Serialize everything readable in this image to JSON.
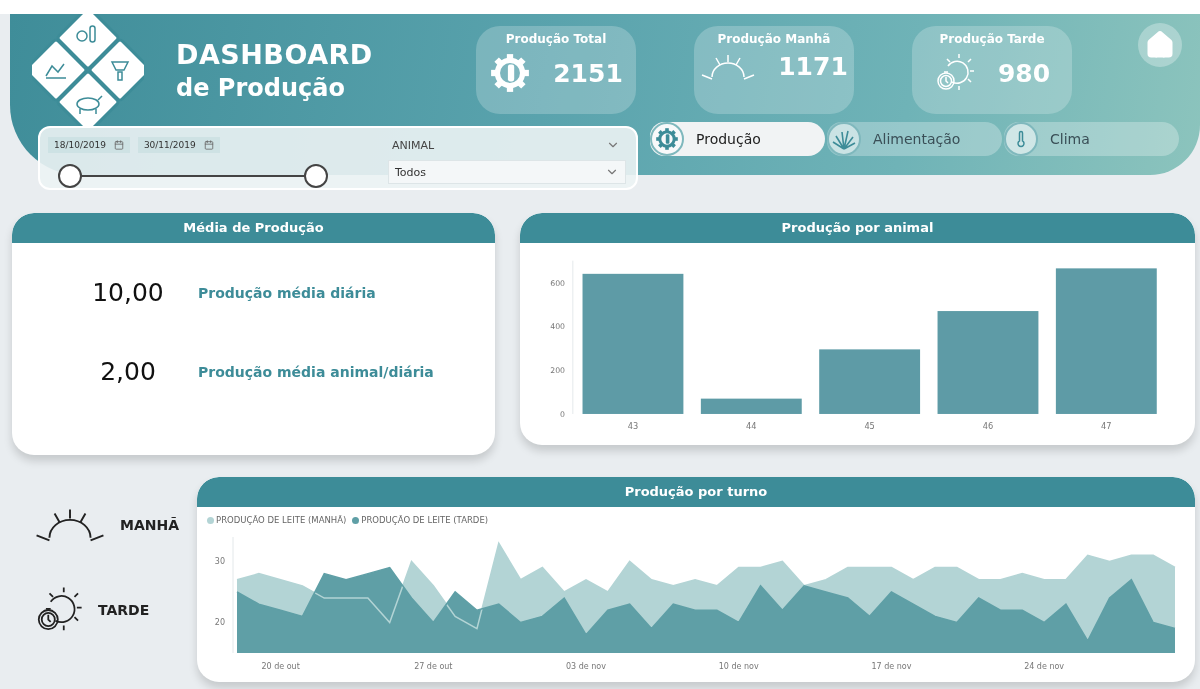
{
  "header": {
    "title": "DASHBOARD",
    "subtitle": "de Produção"
  },
  "kpis": [
    {
      "kind": "gear",
      "title": "Produção Total",
      "value": "2151"
    },
    {
      "kind": "morning",
      "title": "Produção Manhã",
      "value": "1171"
    },
    {
      "kind": "afternoon",
      "title": "Produção Tarde",
      "value": "980"
    }
  ],
  "filters": {
    "date_start": "18/10/2019",
    "date_end": "30/11/2019",
    "date_slider": {
      "thumbs": [
        {
          "level": 0
        },
        {
          "level": 1
        }
      ]
    },
    "animal_label": "ANIMAL",
    "animal_value": "Todos"
  },
  "tabs": [
    {
      "kind": "gear",
      "label": "Produção",
      "selected": true
    },
    {
      "kind": "grass",
      "label": "Alimentação",
      "selected": false
    },
    {
      "kind": "climate",
      "label": "Clima",
      "selected": false
    }
  ],
  "average_card": {
    "title": "Média de Produção",
    "rows": [
      {
        "value": "10,00",
        "label": "Produção média diária"
      },
      {
        "value": "2,00",
        "label": "Produção média animal/diária"
      }
    ]
  },
  "animal_chart": {
    "title": "Produção por animal",
    "chart_data": {
      "type": "bar",
      "categories": [
        "43",
        "44",
        "45",
        "46",
        "47"
      ],
      "values": [
        640,
        70,
        295,
        470,
        665
      ],
      "ylim": [
        0,
        700
      ],
      "yticks": [
        0,
        200,
        400,
        600
      ]
    }
  },
  "shift_legend": [
    {
      "kind": "morning",
      "label": "MANHÃ"
    },
    {
      "kind": "afternoon",
      "label": "TARDE"
    }
  ],
  "shift_chart": {
    "title": "Produção por turno",
    "chart_data": {
      "type": "area",
      "categories": [
        null,
        null,
        "20 de out",
        null,
        null,
        null,
        null,
        null,
        null,
        "27 de out",
        null,
        null,
        null,
        null,
        null,
        null,
        "03 de nov",
        null,
        null,
        null,
        null,
        null,
        null,
        "10 de nov",
        null,
        null,
        null,
        null,
        null,
        null,
        "17 de nov",
        null,
        null,
        null,
        null,
        null,
        null,
        "24 de nov",
        null,
        null,
        null,
        null,
        null,
        null
      ],
      "series": [
        {
          "name": "PRODUÇÃO DE LEITE (MANHÃ)",
          "color": "#b3d4d5",
          "values": [
            27,
            28,
            27,
            26,
            24,
            24,
            24,
            20,
            30,
            26,
            21,
            19,
            33,
            27,
            29,
            25,
            27,
            25,
            30,
            27,
            26,
            27,
            26,
            29,
            29,
            30,
            26,
            27,
            29,
            29,
            29,
            27,
            29,
            29,
            27,
            27,
            28,
            27,
            27,
            31,
            30,
            31,
            31,
            29
          ]
        },
        {
          "name": "PRODUÇÃO DE LEITE (TARDE)",
          "color": "#5f9fa6",
          "values": [
            25,
            23,
            22,
            21,
            28,
            27,
            28,
            29,
            24,
            20,
            25,
            22,
            23,
            20,
            21,
            24,
            18,
            22,
            23,
            19,
            23,
            22,
            22,
            20,
            26,
            22,
            26,
            25,
            24,
            21,
            25,
            23,
            21,
            20,
            24,
            22,
            22,
            20,
            23,
            17,
            24,
            27,
            20,
            19
          ]
        }
      ],
      "ylim": [
        15,
        34
      ],
      "yticks": [
        20,
        30
      ]
    }
  }
}
